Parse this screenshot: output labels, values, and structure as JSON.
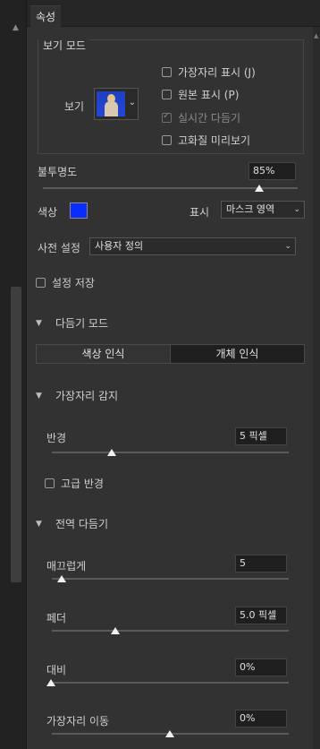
{
  "tab": {
    "label": "속성"
  },
  "view_mode": {
    "title": "보기 모드",
    "view_label": "보기",
    "options": [
      {
        "label": "가장자리 표시 (J)",
        "checked": false,
        "disabled": false
      },
      {
        "label": "원본 표시 (P)",
        "checked": false,
        "disabled": false
      },
      {
        "label": "실시간 다듬기",
        "checked": true,
        "disabled": true
      },
      {
        "label": "고화질 미리보기",
        "checked": false,
        "disabled": false
      }
    ]
  },
  "opacity": {
    "label": "불투명도",
    "value": "85%",
    "level": 0.85
  },
  "color": {
    "label": "색상",
    "swatch": "#0a2dff"
  },
  "display": {
    "label": "표시",
    "value": "마스크 영역"
  },
  "preset": {
    "label": "사전 설정",
    "value": "사용자 정의"
  },
  "save_settings": {
    "label": "설정 저장",
    "checked": false
  },
  "refine_mode": {
    "title": "다듬기 모드",
    "color_aware": "색상 인식",
    "object_aware": "개체 인식",
    "selected": "개체 인식"
  },
  "edge_detection": {
    "title": "가장자리 감지",
    "radius": {
      "label": "반경",
      "value": "5 픽셀"
    },
    "smart_radius": {
      "label": "고급 반경",
      "checked": false
    }
  },
  "global_refinements": {
    "title": "전역 다듬기",
    "smooth": {
      "label": "매끄럽게",
      "value": "5"
    },
    "feather": {
      "label": "페더",
      "value": "5.0 픽셀"
    },
    "contrast": {
      "label": "대비",
      "value": "0%"
    },
    "shift_edge": {
      "label": "가장자리 이동",
      "value": "0%"
    }
  }
}
